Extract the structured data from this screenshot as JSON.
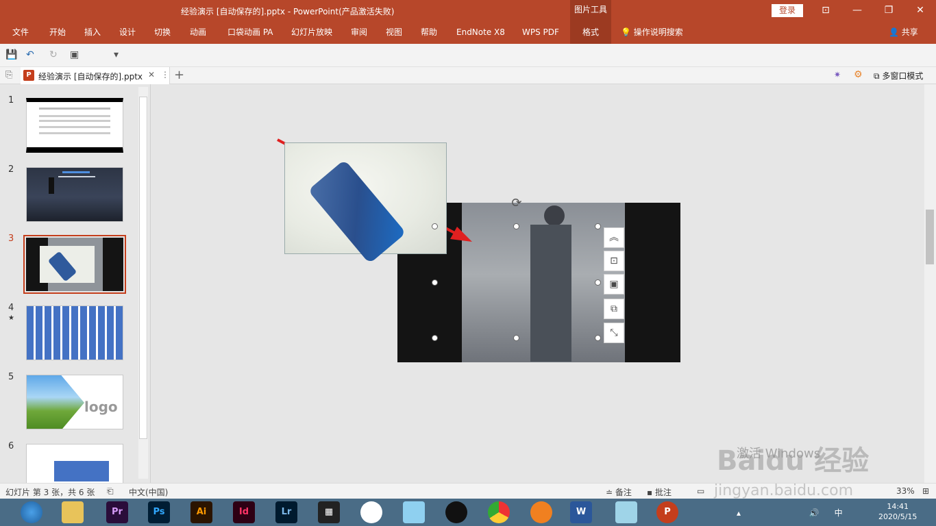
{
  "window": {
    "title": "经验演示 [自动保存的].pptx  -  PowerPoint(产品激活失败)",
    "context_tab": "图片工具",
    "login_label": "登录",
    "controls": {
      "restore_ribbon": "⊡",
      "minimize": "—",
      "maximize": "❐",
      "close": "✕"
    }
  },
  "ribbon": {
    "tabs": [
      "文件",
      "开始",
      "插入",
      "设计",
      "切换",
      "动画",
      "口袋动画 PA",
      "幻灯片放映",
      "审阅",
      "视图",
      "帮助",
      "EndNote X8",
      "WPS PDF",
      "格式"
    ],
    "active_tab": "格式",
    "tell_me": "操作说明搜索",
    "share": "共享"
  },
  "qat": {
    "save": "💾",
    "undo": "↶",
    "redo": "↻",
    "present": "▣",
    "more": "▾"
  },
  "tabbar": {
    "doc_tab_label": "经验演示  [自动保存的].pptx",
    "ppt_badge": "P",
    "close": "✕",
    "menu": "⋮",
    "new_tab": "+",
    "multi_window": "多窗口模式"
  },
  "slides": [
    {
      "number": "1"
    },
    {
      "number": "2"
    },
    {
      "number": "3"
    },
    {
      "number": "4",
      "mark": "★"
    },
    {
      "number": "5",
      "logo_text": "logo"
    },
    {
      "number": "6"
    }
  ],
  "side_buttons": [
    "︽",
    "⊡",
    "▣",
    "⧉",
    "⤡"
  ],
  "statusbar": {
    "slide_info": "幻灯片 第 3 张，共 6 张",
    "language": "中文(中国)",
    "notes": "备注",
    "comments": "批注",
    "zoom": "33%"
  },
  "watermark": {
    "activate": "激活 Windows",
    "brand": "Baidu 经验",
    "url": "jingyan.baidu.com"
  },
  "taskbar": {
    "apps": [
      "Pr",
      "Ps",
      "Ai",
      "Id",
      "Lr",
      "W",
      "P"
    ],
    "clock_time": "14:41",
    "clock_date": "2020/5/15",
    "ime": "中"
  },
  "colors": {
    "accent": "#b7472a",
    "accent_dark": "#9c3a21",
    "selection": "#c43e1c",
    "taskbar": "#4a6c86"
  }
}
